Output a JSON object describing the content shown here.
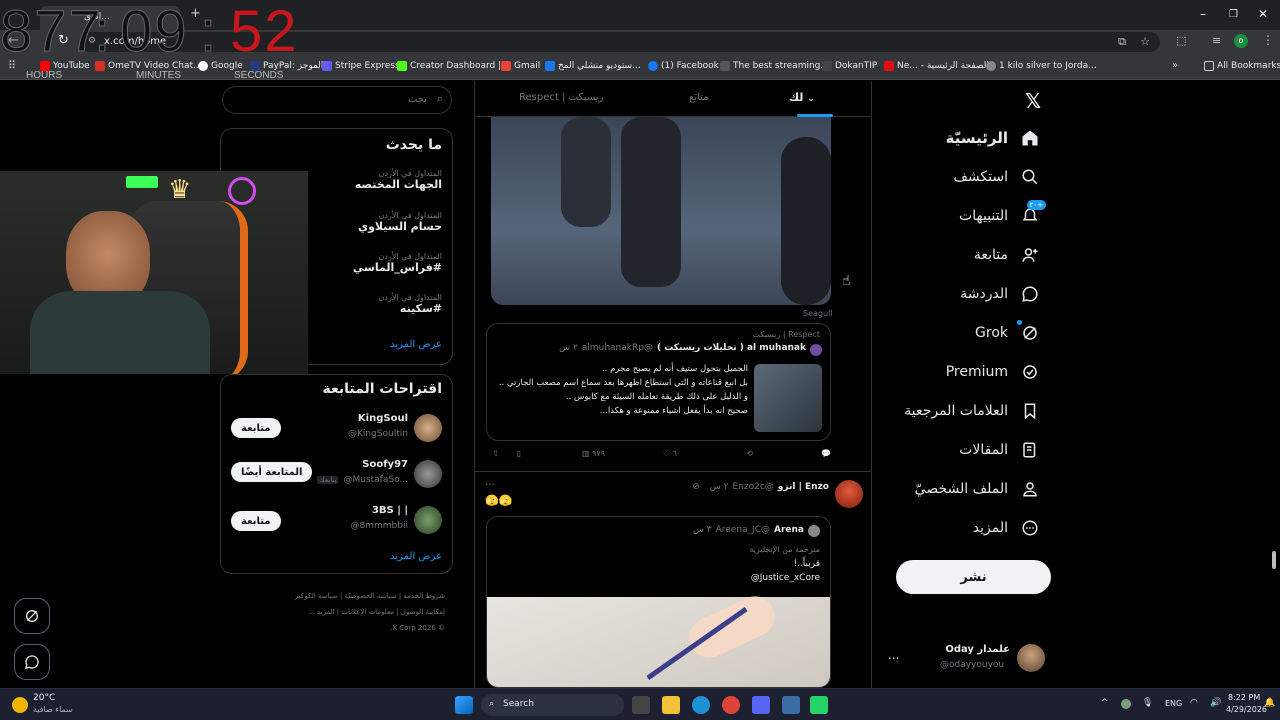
{
  "browser": {
    "tab_title": "الرئ...",
    "url": "x.com/home",
    "bookmarks": [
      "YouTube",
      "OmeTV Video Chat...",
      "Google",
      "PayPal: الموجز",
      "Stripe Express",
      "Creator Dashboard |...",
      "Gmail",
      "ستوديو منشلي المح...",
      "(1) Facebook",
      "The best streaming...",
      "DokanTIP",
      "Ne... - الصفحة الرئيسية",
      "1 kilo silver to Jorda..."
    ],
    "all_bookmarks": "All Bookmarks"
  },
  "timer": {
    "h": "877",
    "m": "09",
    "s": "52",
    "sep": ":",
    "labels": [
      "HOURS",
      "MINUTES",
      "SECONDS"
    ]
  },
  "nav": {
    "items": [
      "الرئيسيّة",
      "استكشف",
      "التنبيهات",
      "متابعة",
      "الدردشة",
      "Grok",
      "Premium",
      "العلامات المرجعية",
      "المقالات",
      "الملف الشخصيّ",
      "المزيد"
    ],
    "notif_badge": "+٢٠",
    "post_button": "نشر",
    "user_name": "علمدار Oday",
    "user_handle": "@odayyouyou",
    "more": "..."
  },
  "feed": {
    "tabs": [
      "لك",
      "متابَع",
      "Respect | ريسبكت"
    ],
    "img_credit": "Seagull",
    "quote": {
      "community": "ريسبكت | Respect",
      "name": "al muhanak ( تحليلات ريسبكت )",
      "handle": "@almuhanakRp",
      "time": "٢ س",
      "lines": [
        "الجميل بتحول ستيف أنه لم يصبح مجرم ..",
        "بل انبع قناعاته و التي استطاع اظهرها بعد سماع اسم مصعب الجارتي ..",
        "و الدليل على ذلك طريقة تعامله السيئة مع كابوس ..",
        "صحيح انه بدأ يفعل اشياء ممنوعة و هكذا..."
      ]
    },
    "actions": {
      "replies": "",
      "retweets": "",
      "likes": "٦",
      "views": "٩٧٩"
    },
    "tweet2": {
      "name": "Enzo | انزو",
      "handle": "@Enzo2c",
      "time": "٢ س",
      "text": "🫣🫣",
      "quote_name": "Arena",
      "quote_handle": "@Areena_JC",
      "quote_time": "٣ س",
      "translated": "مترجمة من الإنجليزية",
      "quote_text": "قريباً..!",
      "mention": "@Justice_xCore"
    }
  },
  "sidebar": {
    "search_placeholder": "بحث",
    "trends_title": "ما يحدث",
    "trends": [
      {
        "meta": "المتداول في الأردن",
        "name": "الجهات المختصه"
      },
      {
        "meta": "المتداول في الأردن",
        "name": "حسام السيلاوي"
      },
      {
        "meta": "المتداول في الأردن",
        "name": "#فراس_الماسي"
      },
      {
        "meta": "المتداول في الأردن",
        "name": "#سكينه"
      }
    ],
    "show_more": "عرض المزيد",
    "follow_title": "اقتراحات المتابعة",
    "suggestions": [
      {
        "name": "KingSoul",
        "handle": "@KingSoultin",
        "button": "متابعة",
        "badge": ""
      },
      {
        "name": "Soofy97",
        "handle": "@MustafaSo...",
        "button": "المتابعة أيضًا",
        "badge": "يتابعك"
      },
      {
        "name": "3BS | |",
        "handle": "@8mmmbbii",
        "button": "متابعة",
        "badge": ""
      }
    ],
    "footer": [
      "شروط الخدمة",
      "سياسة الخصوصيّة",
      "سياسة الكوكيز",
      "إمكانية الوصول",
      "معلومات الإعلانات",
      "المزيد ...",
      "© 2026 X Corp."
    ]
  },
  "taskbar": {
    "weather_temp": "20°C",
    "weather_desc": "سماء صافية",
    "search": "Search",
    "lang": "ENG",
    "time": "8:22 PM",
    "date": "4/29/2026"
  }
}
